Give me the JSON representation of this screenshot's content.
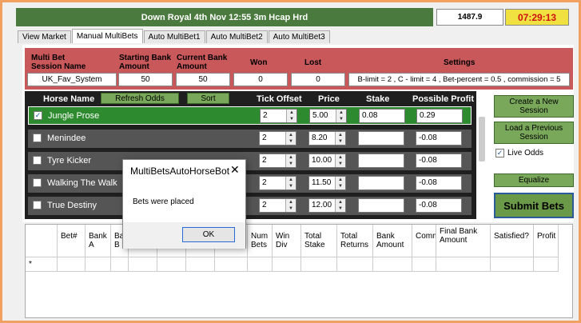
{
  "header": {
    "race_title": "Down Royal 4th Nov 12:55 3m Hcap Hrd",
    "bank": "1487.9",
    "clock": "07:29:13"
  },
  "tabs": [
    "View Market",
    "Manual MultiBets",
    "Auto MultiBet1",
    "Auto MultiBet2",
    "Auto MultiBet3"
  ],
  "active_tab": "Manual MultiBets",
  "session": {
    "headers": {
      "name": "Multi Bet Session Name",
      "starting": "Starting Bank Amount",
      "current": "Current Bank Amount",
      "won": "Won",
      "lost": "Lost",
      "settings": "Settings"
    },
    "values": {
      "name": "UK_Fav_System",
      "starting": "50",
      "current": "50",
      "won": "0",
      "lost": "0",
      "settings": "B-limit = 2 , C - limit = 4 , Bet-percent = 0.5 , commission = 5"
    }
  },
  "list_headers": {
    "horse": "Horse Name",
    "refresh": "Refresh Odds",
    "sort": "Sort",
    "tick": "Tick Offset",
    "price": "Price",
    "stake": "Stake",
    "profit": "Possible Profit"
  },
  "horses": [
    {
      "name": "Jungle Prose",
      "checked": true,
      "tick": "2",
      "price": "5.00",
      "stake": "0.08",
      "profit": "0.29"
    },
    {
      "name": "Menindee",
      "checked": false,
      "tick": "2",
      "price": "8.20",
      "stake": "",
      "profit": "-0.08"
    },
    {
      "name": "Tyre Kicker",
      "checked": false,
      "tick": "2",
      "price": "10.00",
      "stake": "",
      "profit": "-0.08"
    },
    {
      "name": "Walking The Walk",
      "checked": false,
      "tick": "2",
      "price": "11.50",
      "stake": "",
      "profit": "-0.08"
    },
    {
      "name": "True Destiny",
      "checked": false,
      "tick": "2",
      "price": "12.00",
      "stake": "",
      "profit": "-0.08"
    }
  ],
  "side_buttons": {
    "create": "Create a New Session",
    "load": "Load a Previous Session",
    "live_odds": "Live Odds",
    "equalize": "Equalize",
    "submit": "Submit Bets"
  },
  "grid": {
    "columns": [
      "Bet#",
      "Bank A",
      "Ba B",
      "",
      "",
      "",
      "",
      "Num Bets",
      "Win Div",
      "Total Stake",
      "Total Returns",
      "Bank Amount",
      "Comm",
      "Final Bank Amount",
      "Satisfied?",
      "Profit"
    ],
    "new_row_marker": "*"
  },
  "dialog": {
    "title": "MultiBetsAutoHorseBot",
    "close": "✕",
    "message": "Bets were placed",
    "ok": "OK"
  }
}
